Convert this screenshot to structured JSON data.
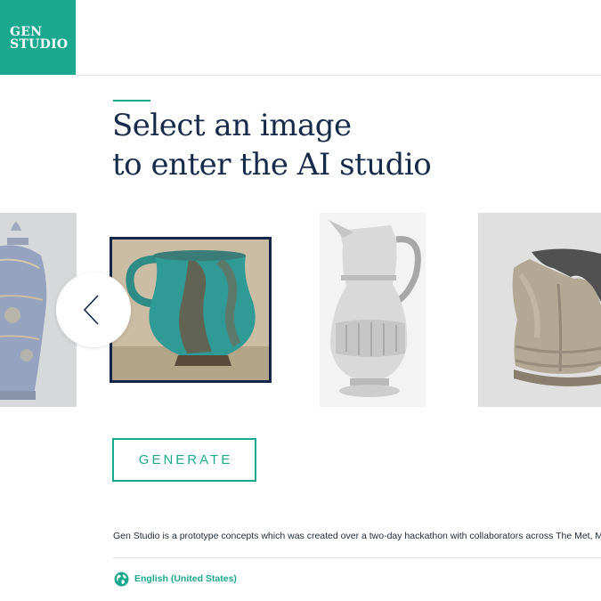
{
  "logo": {
    "line1": "GEN",
    "line2": "STUDIO"
  },
  "heading": {
    "line1": "Select an image",
    "line2": "to enter the AI studio"
  },
  "carousel": {
    "items": [
      {
        "subject": "blue and white covered vase",
        "selected": false
      },
      {
        "subject": "turquoise glazed jug",
        "selected": true
      },
      {
        "subject": "silver ewer",
        "selected": false
      },
      {
        "subject": "steel breastplate",
        "selected": false
      }
    ],
    "prev_icon": "chevron-left-icon"
  },
  "actions": {
    "generate_label": "GENERATE"
  },
  "footer": {
    "description": "Gen Studio is a prototype concepts which was created over a two-day hackathon with collaborators across The Met, Microsoft and MIT.",
    "language_icon": "globe-icon",
    "language_label": "English (United States)"
  },
  "colors": {
    "brand": "#1aa88e",
    "heading": "#162a4a",
    "selection_border": "#14274a"
  }
}
